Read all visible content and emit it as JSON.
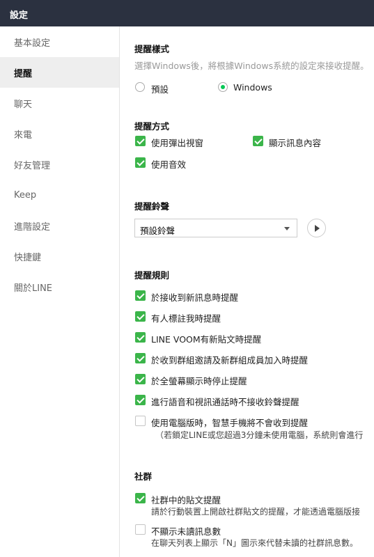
{
  "window": {
    "title": "設定"
  },
  "sidebar": {
    "items": [
      {
        "label": "基本設定"
      },
      {
        "label": "提醒"
      },
      {
        "label": "聊天"
      },
      {
        "label": "來電"
      },
      {
        "label": "好友管理"
      },
      {
        "label": "Keep"
      },
      {
        "label": "進階設定"
      },
      {
        "label": "快捷鍵"
      },
      {
        "label": "關於LINE"
      }
    ],
    "active_index": 1
  },
  "style_section": {
    "title": "提醒樣式",
    "description": "選擇Windows後，將根據Windows系統的設定來接收提醒。",
    "options": [
      {
        "label": "預設",
        "selected": false
      },
      {
        "label": "Windows",
        "selected": true
      }
    ]
  },
  "method_section": {
    "title": "提醒方式",
    "options": [
      {
        "label": "使用彈出視窗",
        "checked": true
      },
      {
        "label": "顯示訊息內容",
        "checked": true
      },
      {
        "label": "使用音效",
        "checked": true
      }
    ]
  },
  "ringtone_section": {
    "title": "提醒鈴聲",
    "selected": "預設鈴聲"
  },
  "rules_section": {
    "title": "提醒規則",
    "options": [
      {
        "label": "於接收到新訊息時提醒",
        "checked": true
      },
      {
        "label": "有人標註我時提醒",
        "checked": true
      },
      {
        "label": "LINE VOOM有新貼文時提醒",
        "checked": true
      },
      {
        "label": "於收到群組邀請及新群組成員加入時提醒",
        "checked": true
      },
      {
        "label": "於全螢幕顯示時停止提醒",
        "checked": true
      },
      {
        "label": "進行語音和視訊通話時不接收鈴聲提醒",
        "checked": true
      },
      {
        "label": "使用電腦版時，智慧手機將不會收到提醒",
        "sub": "（若鎖定LINE或您超過3分鐘未使用電腦，系統則會進行",
        "checked": false
      }
    ]
  },
  "community_section": {
    "title": "社群",
    "options": [
      {
        "label": "社群中的貼文提醒",
        "sub": "請於行動裝置上開啟社群貼文的提醒，才能透過電腦版接",
        "checked": true
      },
      {
        "label": "不顯示未讀訊息數",
        "sub": "在聊天列表上顯示「N」圖示來代替未讀的社群訊息數。",
        "checked": false
      }
    ]
  },
  "colors": {
    "titlebar": "#2b3140",
    "accent": "#3bb54a",
    "radio": "#06c755"
  }
}
